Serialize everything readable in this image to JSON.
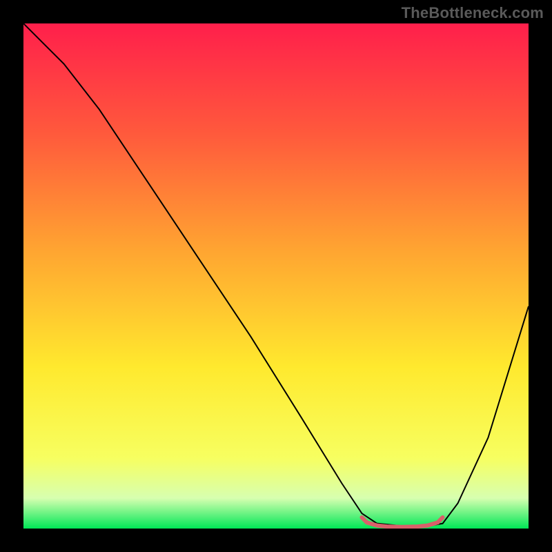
{
  "watermark": {
    "text": "TheBottleneck.com"
  },
  "chart_data": {
    "type": "line",
    "title": "",
    "xlabel": "",
    "ylabel": "",
    "xlim": [
      0,
      100
    ],
    "ylim": [
      0,
      100
    ],
    "gradient_stops": [
      {
        "offset": 0,
        "color": "#ff1f4b"
      },
      {
        "offset": 22,
        "color": "#ff5a3c"
      },
      {
        "offset": 45,
        "color": "#ffa531"
      },
      {
        "offset": 68,
        "color": "#ffe92e"
      },
      {
        "offset": 86,
        "color": "#f7ff60"
      },
      {
        "offset": 94,
        "color": "#d7ffb0"
      },
      {
        "offset": 100,
        "color": "#00e756"
      }
    ],
    "series": [
      {
        "name": "bottleneck-curve",
        "color": "#000000",
        "width": 2,
        "x": [
          0,
          4,
          8,
          15,
          25,
          35,
          45,
          55,
          63,
          67,
          70,
          75,
          80,
          83,
          86,
          92,
          100
        ],
        "values": [
          100,
          96,
          92,
          83,
          68,
          53,
          38,
          22,
          9,
          3,
          1,
          0.5,
          0.5,
          1,
          5,
          18,
          44
        ]
      },
      {
        "name": "optimal-range-marker",
        "color": "#d9606a",
        "width": 6,
        "x": [
          67,
          68,
          70,
          72,
          75,
          78,
          80,
          82,
          83
        ],
        "values": [
          2.2,
          1.2,
          0.6,
          0.4,
          0.3,
          0.4,
          0.6,
          1.2,
          2.2
        ]
      }
    ],
    "optimal_range": {
      "start": 67,
      "end": 83
    }
  }
}
